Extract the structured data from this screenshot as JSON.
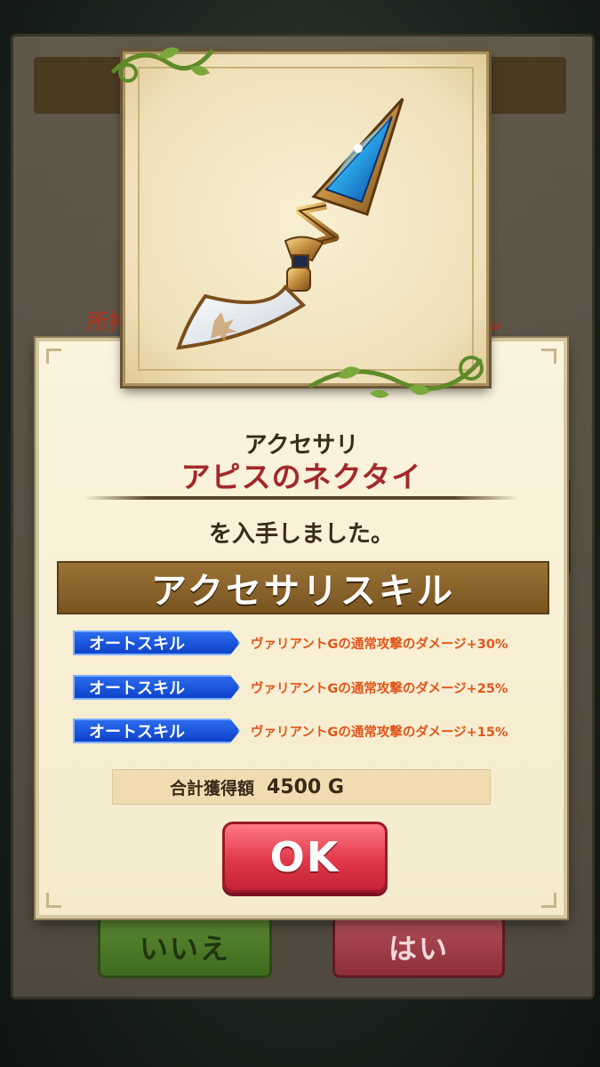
{
  "background": {
    "owned_text_left": "所持",
    "owned_text_right": "ん",
    "no_button": "いいえ",
    "yes_button": "はい"
  },
  "popup": {
    "category": "アクセサリ",
    "item_name": "アピスのネクタイ",
    "obtained_text": "を入手しました。",
    "skill_section_title": "アクセサリスキル",
    "skills": [
      {
        "tag": "オートスキル",
        "description": "ヴァリアントGの通常攻撃のダメージ+30%"
      },
      {
        "tag": "オートスキル",
        "description": "ヴァリアントGの通常攻撃のダメージ+25%"
      },
      {
        "tag": "オートスキル",
        "description": "ヴァリアントGの通常攻撃のダメージ+15%"
      }
    ],
    "total_label": "合計獲得額",
    "total_value": "4500 G",
    "ok_label": "OK"
  },
  "item_icon": "necktie-accessory-icon",
  "colors": {
    "item_name": "#a3282a",
    "skill_tag": "#1a4fdc",
    "skill_desc": "#e0561a",
    "ok_button": "#e0384a"
  }
}
